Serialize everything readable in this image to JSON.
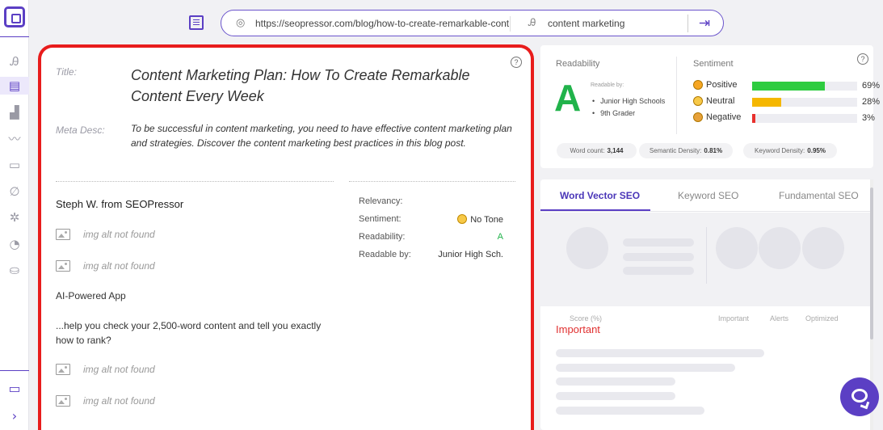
{
  "url_bar": {
    "url": "https://seopressor.com/blog/how-to-create-remarkable-content",
    "keyword": "content marketing",
    "go_icon": "arrow-enter-icon",
    "url_icon": "target-icon",
    "keyword_icon": "keyword-icon"
  },
  "sidebar": {
    "logo": "app-logo-icon",
    "items": [
      "text-style-icon",
      "page-icon",
      "chart-icon",
      "trend-icon",
      "document-icon",
      "link-icon",
      "settings-icon",
      "pie-icon",
      "users-icon"
    ],
    "bottom": [
      "folder-icon",
      "expand-arrow-icon"
    ]
  },
  "page": {
    "title_label": "Title:",
    "title": "Content Marketing Plan: How To Create Remarkable Content Every Week",
    "meta_label": "Meta Desc:",
    "meta": "To be successful in content marketing, you need to have effective content marketing plan and strategies. Discover the content marketing best practices in this blog post.",
    "author": "Steph W. from SEOPressor",
    "img_alt_1": "img alt not found",
    "img_alt_2": "img alt not found",
    "ai_heading": "AI-Powered App",
    "paragraph": "...help you check your 2,500-word content and tell you exactly how to rank?",
    "img_alt_3": "img alt not found",
    "img_alt_4": "img alt not found",
    "stats": {
      "relevancy_label": "Relevancy:",
      "sentiment_label": "Sentiment:",
      "sentiment_value": "No Tone",
      "readability_label": "Readability:",
      "readability_value": "A",
      "readable_label": "Readable by:",
      "readable_value": "Junior High Sch."
    }
  },
  "readability_card": {
    "title": "Readability",
    "grade": "A",
    "readable_by_label": "Readable by:",
    "readable_by": [
      "Junior High Schools",
      "9th Grader"
    ],
    "sentiment_title": "Sentiment",
    "sentiment": [
      {
        "label": "Positive",
        "pct": "69%",
        "value": 69,
        "color": "#2ecc40",
        "emoji": "smile"
      },
      {
        "label": "Neutral",
        "pct": "28%",
        "value": 28,
        "color": "#f5b700",
        "emoji": "neutral"
      },
      {
        "label": "Negative",
        "pct": "3%",
        "value": 3,
        "color": "#e8302d",
        "emoji": "sad"
      }
    ],
    "word_count_label": "Word count:",
    "word_count": "3,144",
    "semantic_label": "Semantic Density:",
    "semantic": "0.81%",
    "keyword_label": "Keyword Density:",
    "keyword": "0.95%"
  },
  "seo_card": {
    "tabs": [
      "Word Vector SEO",
      "Keyword SEO",
      "Fundamental SEO"
    ],
    "score_label": "Score (%)",
    "important_label": "Important",
    "alerts_label": "Alerts",
    "optimized_label": "Optimized",
    "important_title": "Important"
  },
  "colors": {
    "accent": "#5b3fc4",
    "highlight_border": "#e81c1c",
    "grade_green": "#21b34b"
  }
}
